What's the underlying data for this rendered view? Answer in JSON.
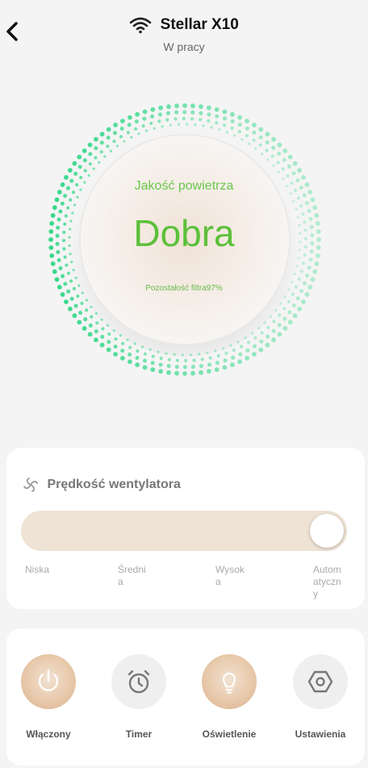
{
  "header": {
    "title": "Stellar X10",
    "status": "W pracy"
  },
  "air_quality": {
    "label": "Jakość powietrza",
    "value": "Dobra",
    "filter_text": "Pozostałość filtra97%",
    "accent_color": "#5cc03a",
    "ring_color": "#35d88a"
  },
  "fan": {
    "title": "Prędkość wentylatora",
    "levels": [
      "Niska",
      "Średnia",
      "Wysoka",
      "Automatyczny"
    ],
    "level_display": [
      "Niska",
      "Średnia",
      "Wysok a",
      "Autom atyczn y"
    ],
    "selected_index": 3,
    "track_color": "#eee3d5"
  },
  "controls": [
    {
      "label": "Włączony",
      "icon": "power-icon"
    },
    {
      "label": "Timer",
      "icon": "timer-icon"
    },
    {
      "label": "Oświetlenie",
      "icon": "lightbulb-icon"
    },
    {
      "label": "Ustawienia",
      "icon": "settings-icon"
    }
  ]
}
